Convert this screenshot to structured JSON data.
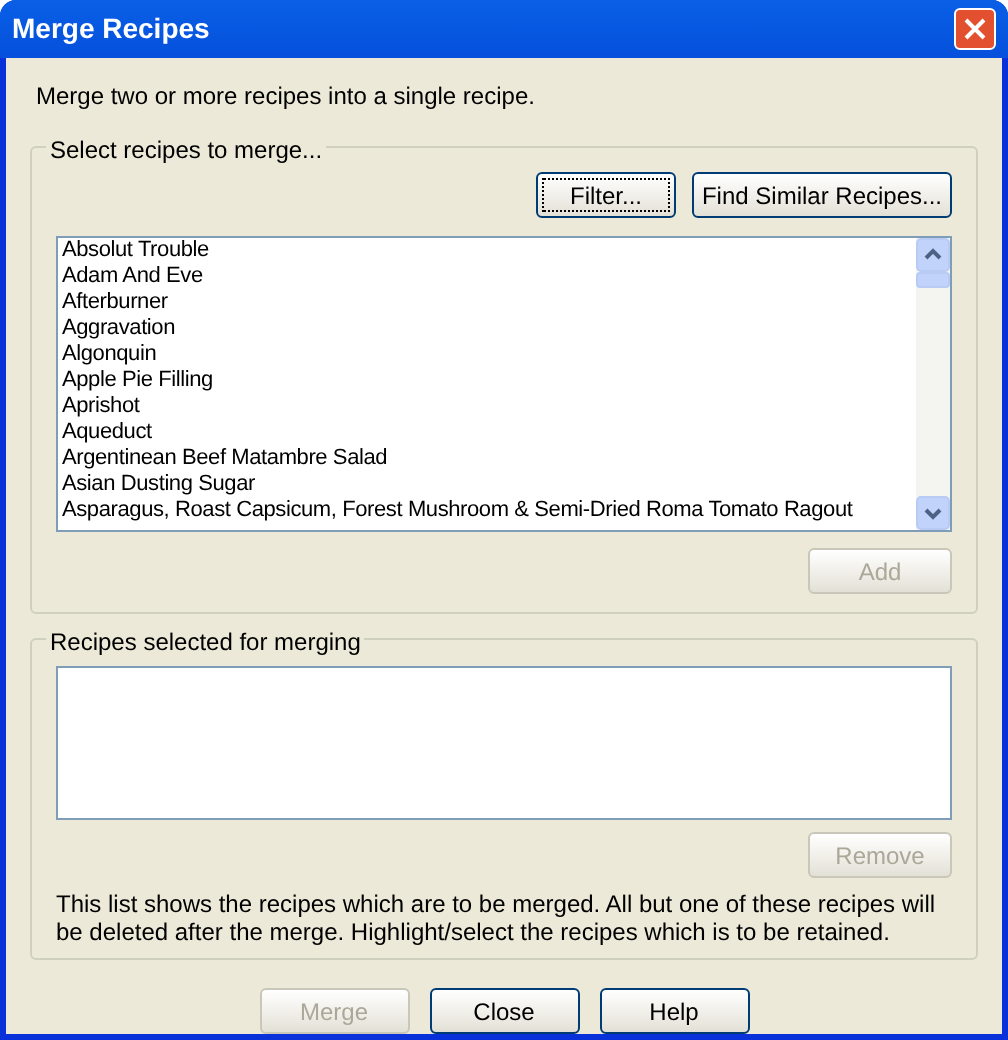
{
  "window": {
    "title": "Merge Recipes"
  },
  "intro": "Merge two or more recipes into a single recipe.",
  "select_group": {
    "title": "Select recipes to merge...",
    "buttons": [
      {
        "label": "Filter...",
        "disabled": false,
        "focused": true
      },
      {
        "label": "Find Similar Recipes...",
        "disabled": false,
        "focused": false
      }
    ],
    "recipes": [
      "Absolut Trouble",
      "Adam And Eve",
      "Afterburner",
      "Aggravation",
      "Algonquin",
      "Apple Pie Filling",
      "Aprishot",
      "Aqueduct",
      "Argentinean Beef Matambre Salad",
      "Asian Dusting Sugar",
      "Asparagus, Roast Capsicum, Forest Mushroom & Semi-Dried Roma Tomato Ragout"
    ],
    "add_button": {
      "label": "Add",
      "disabled": true
    }
  },
  "merge_group": {
    "title": "Recipes selected for merging",
    "remove_button": {
      "label": "Remove",
      "disabled": true
    },
    "note": "This list shows the recipes which are to be merged.  All but one of these recipes will be deleted after the merge.  Highlight/select the recipes which is to be retained."
  },
  "buttons": [
    {
      "label": "Merge",
      "disabled": true
    },
    {
      "label": "Close",
      "disabled": false
    },
    {
      "label": "Help",
      "disabled": false
    }
  ]
}
